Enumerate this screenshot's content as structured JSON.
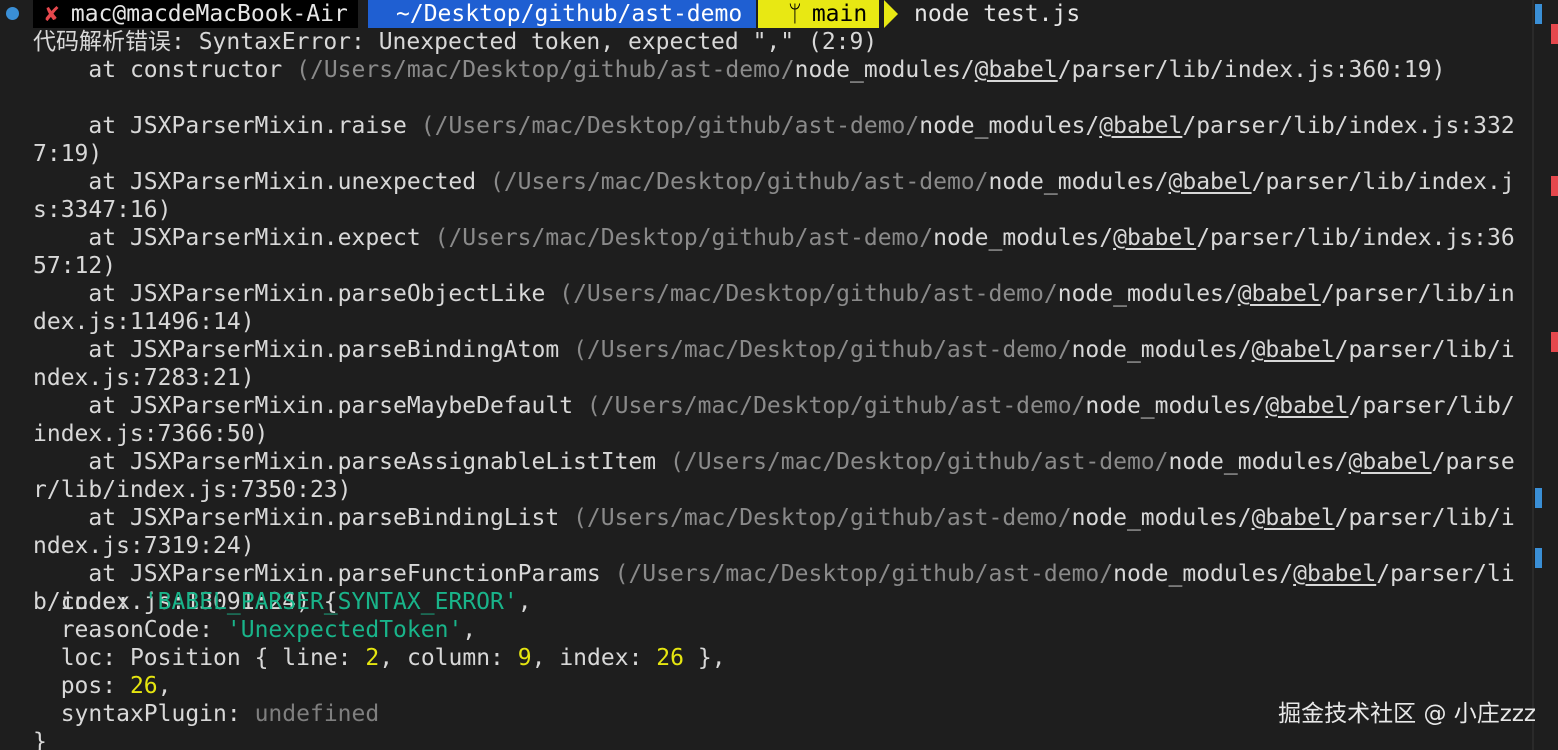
{
  "prompt": {
    "status_icon": "x-mark-icon",
    "user_host": "mac@macdeMacBook-Air",
    "path": "~/Desktop/github/ast-demo",
    "branch_icon": "git-branch-icon",
    "branch": "main",
    "command": "node test.js"
  },
  "error_header": "代码解析错误: SyntaxError: Unexpected token, expected \",\" (2:9)",
  "stack": [
    {
      "fn": "constructor",
      "path_pre": "(/Users/mac/Desktop/github/ast-demo/",
      "path_mid": "node_modules/",
      "pkg": "@babel",
      "path_post": "/parser/lib/index.js:360:19)",
      "wrap": ""
    },
    {
      "fn": "JSXParserMixin.raise",
      "path_pre": "(/Users/mac/Desktop/github/ast-demo/",
      "path_mid": "node_modules/",
      "pkg": "@babel",
      "path_post": "/parser/lib/index.js:332",
      "wrap": "7:19)"
    },
    {
      "fn": "JSXParserMixin.unexpected",
      "path_pre": "(/Users/mac/Desktop/github/ast-demo/",
      "path_mid": "node_modules/",
      "pkg": "@babel",
      "path_post": "/parser/lib/index.j",
      "wrap": "s:3347:16)"
    },
    {
      "fn": "JSXParserMixin.expect",
      "path_pre": "(/Users/mac/Desktop/github/ast-demo/",
      "path_mid": "node_modules/",
      "pkg": "@babel",
      "path_post": "/parser/lib/index.js:36",
      "wrap": "57:12)"
    },
    {
      "fn": "JSXParserMixin.parseObjectLike",
      "path_pre": "(/Users/mac/Desktop/github/ast-demo/",
      "path_mid": "node_modules/",
      "pkg": "@babel",
      "path_post": "/parser/lib/in",
      "wrap": "dex.js:11496:14)"
    },
    {
      "fn": "JSXParserMixin.parseBindingAtom",
      "path_pre": "(/Users/mac/Desktop/github/ast-demo/",
      "path_mid": "node_modules/",
      "pkg": "@babel",
      "path_post": "/parser/lib/i",
      "wrap": "ndex.js:7283:21)"
    },
    {
      "fn": "JSXParserMixin.parseMaybeDefault",
      "path_pre": "(/Users/mac/Desktop/github/ast-demo/",
      "path_mid": "node_modules/",
      "pkg": "@babel",
      "path_post": "/parser/lib/",
      "wrap": "index.js:7366:50)"
    },
    {
      "fn": "JSXParserMixin.parseAssignableListItem",
      "path_pre": "(/Users/mac/Desktop/github/ast-demo/",
      "path_mid": "node_modules/",
      "pkg": "@babel",
      "path_post": "/parse",
      "wrap": "r/lib/index.js:7350:23)"
    },
    {
      "fn": "JSXParserMixin.parseBindingList",
      "path_pre": "(/Users/mac/Desktop/github/ast-demo/",
      "path_mid": "node_modules/",
      "pkg": "@babel",
      "path_post": "/parser/lib/i",
      "wrap": "ndex.js:7319:24)"
    },
    {
      "fn": "JSXParserMixin.parseFunctionParams",
      "path_pre": "(/Users/mac/Desktop/github/ast-demo/",
      "path_mid": "node_modules/",
      "pkg": "@babel",
      "path_post": "/parser/li",
      "wrap": "b/index.js:13091:24) {"
    }
  ],
  "error_props": {
    "code_key": "code:",
    "code_val": "'BABEL_PARSER_SYNTAX_ERROR'",
    "reason_key": "reasonCode:",
    "reason_val": "'UnexpectedToken'",
    "loc_key": "loc:",
    "loc_type": "Position {",
    "line_key": "line:",
    "line_val": "2",
    "column_key": "column:",
    "column_val": "9",
    "index_key": "index:",
    "index_val": "26",
    "loc_close": "},",
    "pos_key": "pos:",
    "pos_val": "26",
    "plugin_key": "syntaxPlugin:",
    "plugin_val": "undefined",
    "close": "}"
  },
  "watermark": "掘金技术社区 @ 小庄zzz",
  "colors": {
    "background": "#1e1e1e",
    "path_segment": "#1f5fd2",
    "branch_segment": "#e8e813",
    "string": "#19b48a",
    "number": "#e5e510",
    "error_mark": "#e5484d"
  }
}
